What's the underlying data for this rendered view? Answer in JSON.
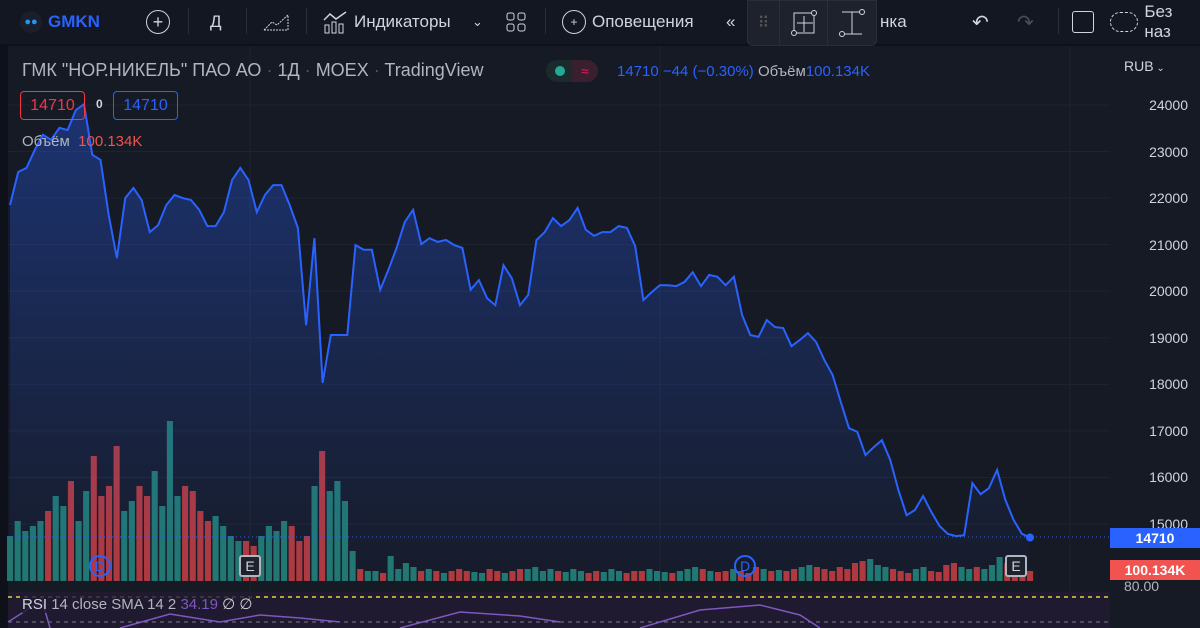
{
  "toolbar": {
    "symbol": "GMKN",
    "interval": "Д",
    "indicators_label": "Индикаторы",
    "alerts_label": "Оповещения",
    "hidden_label": "нка",
    "layout_name": "Без наз"
  },
  "legend": {
    "title": "ГМК \"НОР.НИКЕЛЬ\" ПАО АО",
    "interval": "1Д",
    "exchange": "MOEX",
    "source": "TradingView",
    "sep": "·",
    "sell_price": "14710",
    "spread": "0",
    "buy_price": "14710",
    "volume_label": "Объём",
    "volume_value": "100.134K",
    "last": "14710",
    "change": "−44 (−0.30%)",
    "volume_label2": "Объём",
    "volume_value2": "100.134K"
  },
  "axis": {
    "currency": "RUB",
    "ticks": [
      "24000",
      "23000",
      "22000",
      "21000",
      "20000",
      "19000",
      "18000",
      "17000",
      "16000",
      "15000"
    ],
    "last_price_tag": "14710",
    "volume_tag": "100.134K",
    "rsi_tick": "80.00"
  },
  "markers": {
    "dividend": "D",
    "earnings": "E"
  },
  "rsi": {
    "name": "RSI",
    "params": "14 close SMA 14 2",
    "value": "34.19",
    "extra1": "∅",
    "extra2": "∅"
  },
  "colors": {
    "line": "#2962ff",
    "up": "#22786e",
    "down": "#b2383a",
    "bg": "#161a25"
  },
  "chart_data": {
    "type": "line",
    "title": "ГМК \"НОР.НИКЕЛЬ\" ПАО АО · 1Д · MOEX",
    "ylim": [
      15000,
      24000
    ],
    "prices": [
      21850,
      22560,
      22650,
      23030,
      23360,
      23250,
      23510,
      23460,
      23890,
      24020,
      22930,
      22820,
      21640,
      20710,
      22000,
      22220,
      21960,
      21270,
      21420,
      21850,
      22070,
      22000,
      21960,
      21750,
      21400,
      21400,
      21700,
      22390,
      22650,
      22390,
      21700,
      22070,
      22280,
      22280,
      21850,
      21360,
      19270,
      21140,
      18030,
      19060,
      19060,
      19060,
      20990,
      20890,
      20890,
      20030,
      20460,
      20930,
      21490,
      21750,
      21010,
      21140,
      21060,
      21100,
      20990,
      20930,
      20030,
      20240,
      19850,
      19700,
      20560,
      20280,
      19700,
      19920,
      21100,
      21270,
      21570,
      21400,
      21530,
      21790,
      21320,
      21190,
      21270,
      21270,
      21400,
      21360,
      20970,
      19810,
      19980,
      20130,
      20130,
      20110,
      20200,
      20410,
      20110,
      20350,
      20310,
      20130,
      20310,
      19490,
      19060,
      19020,
      19380,
      19230,
      19210,
      18820,
      18950,
      19100,
      18910,
      18520,
      18200,
      17620,
      17060,
      16980,
      16480,
      16650,
      16800,
      16380,
      15730,
      15190,
      15300,
      15600,
      15260,
      14960,
      14790,
      14740,
      14760,
      15880,
      15640,
      15770,
      16160,
      15520,
      15090,
      14790,
      14710
    ],
    "volumes_k": [
      450,
      600,
      500,
      550,
      600,
      700,
      850,
      750,
      1000,
      600,
      900,
      1250,
      850,
      950,
      1350,
      700,
      800,
      950,
      850,
      1100,
      750,
      1600,
      850,
      950,
      900,
      700,
      600,
      650,
      550,
      450,
      400,
      400,
      350,
      450,
      550,
      500,
      600,
      550,
      400,
      450,
      950,
      1300,
      900,
      1000,
      800,
      300,
      120,
      100,
      100,
      80,
      250,
      120,
      180,
      140,
      100,
      120,
      100,
      80,
      100,
      120,
      100,
      90,
      80,
      120,
      100,
      80,
      100,
      120,
      120,
      140,
      100,
      120,
      100,
      90,
      120,
      100,
      80,
      100,
      90,
      120,
      100,
      80,
      100,
      100,
      120,
      100,
      90,
      80,
      100,
      120,
      140,
      120,
      100,
      90,
      100,
      120,
      100,
      80,
      140,
      120,
      100,
      110,
      100,
      120,
      140,
      160,
      140,
      120,
      100,
      140,
      120,
      180,
      200,
      220,
      160,
      140,
      120,
      100,
      80,
      120,
      140,
      100,
      90,
      160,
      180,
      140,
      120,
      140,
      120,
      160,
      240,
      180,
      140,
      120,
      100
    ]
  }
}
